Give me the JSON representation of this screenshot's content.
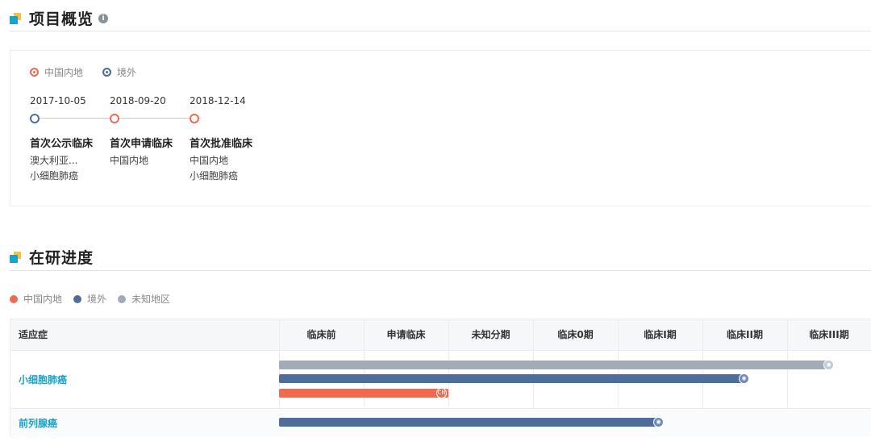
{
  "overview": {
    "title": "项目概览",
    "info_icon": "i",
    "legend": [
      {
        "label": "中国内地",
        "color": "#f06a50"
      },
      {
        "label": "境外",
        "color": "#4f6d9a"
      }
    ],
    "events": [
      {
        "date": "2017-10-05",
        "title": "首次公示临床",
        "line1": "澳大利亚...",
        "line2": "小细胞肺癌",
        "region_color": "#4f6d9a"
      },
      {
        "date": "2018-09-20",
        "title": "首次申请临床",
        "line1": "中国内地",
        "line2": "",
        "region_color": "#f06a50"
      },
      {
        "date": "2018-12-14",
        "title": "首次批准临床",
        "line1": "中国内地",
        "line2": "小细胞肺癌",
        "region_color": "#f06a50"
      }
    ]
  },
  "progress": {
    "title": "在研进度",
    "legend": [
      {
        "label": "中国内地",
        "color": "#f06a50"
      },
      {
        "label": "境外",
        "color": "#4f6d9a"
      },
      {
        "label": "未知地区",
        "color": "#a3abb8"
      }
    ],
    "columns": [
      "适应症",
      "临床前",
      "申请临床",
      "未知分期",
      "临床0期",
      "临床I期",
      "临床II期",
      "临床III期"
    ],
    "rows": [
      {
        "indication": "小细胞肺癌",
        "bars": [
          {
            "region": "未知地区",
            "stage": "临床III期",
            "color": "#a3abb8",
            "marker": "globe-icon",
            "marker_text": ""
          },
          {
            "region": "境外",
            "stage": "临床II期",
            "color": "#4f6d9a",
            "marker": "globe-icon",
            "marker_text": ""
          },
          {
            "region": "中国内地",
            "stage": "申请临床",
            "color": "#f06a50",
            "marker": "cn-badge-icon",
            "marker_text": "CN"
          }
        ]
      },
      {
        "indication": "前列腺癌",
        "bars": [
          {
            "region": "境外",
            "stage": "临床I期",
            "color": "#4f6d9a",
            "marker": "globe-icon",
            "marker_text": ""
          }
        ]
      }
    ]
  }
}
